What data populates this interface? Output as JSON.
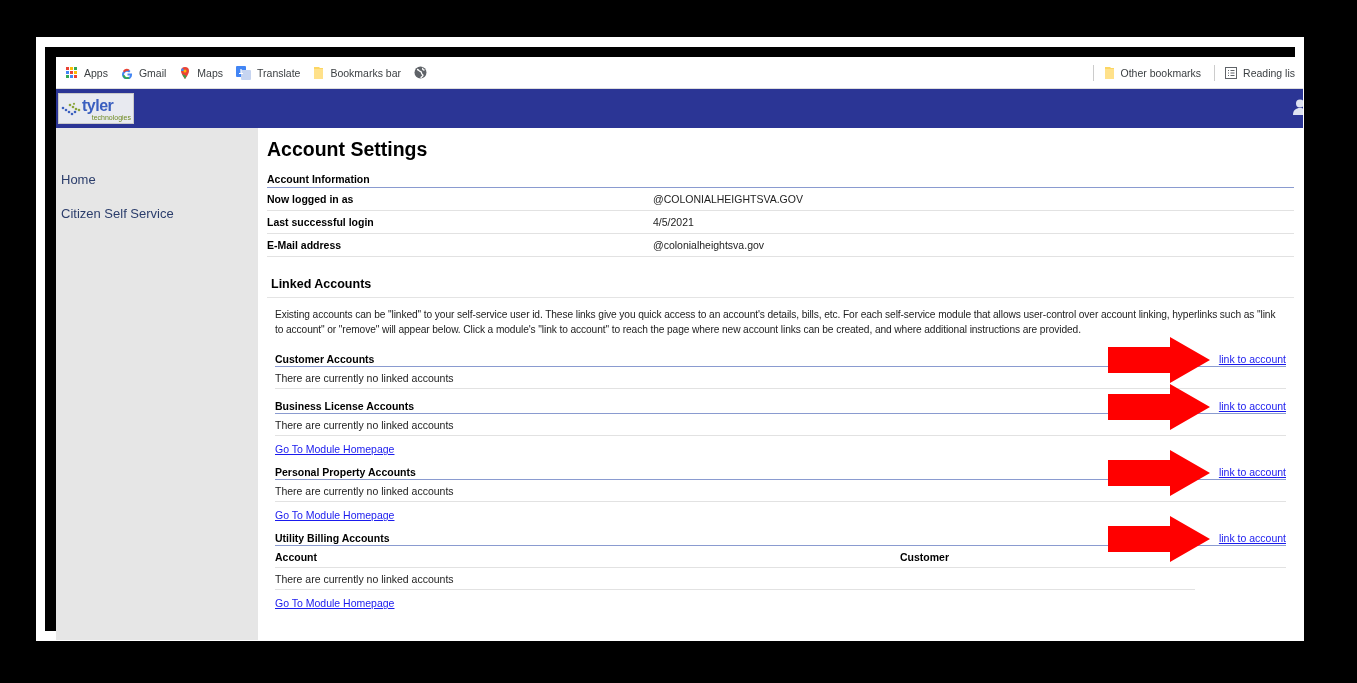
{
  "bookmarks_bar": {
    "items": [
      {
        "kind": "apps",
        "label": "Apps"
      },
      {
        "kind": "gmail",
        "label": "Gmail"
      },
      {
        "kind": "maps",
        "label": "Maps"
      },
      {
        "kind": "translate",
        "label": "Translate"
      },
      {
        "kind": "folder",
        "label": "Bookmarks bar"
      },
      {
        "kind": "globe"
      }
    ],
    "right_items": [
      {
        "kind": "folder",
        "label": "Other bookmarks"
      },
      {
        "kind": "reading",
        "label": "Reading lis"
      }
    ]
  },
  "header": {
    "logo": {
      "name": "tyler",
      "subtitle": "technologies"
    }
  },
  "sidebar": {
    "items": [
      "Home",
      "Citizen Self Service"
    ]
  },
  "page": {
    "title": "Account Settings",
    "account_information": {
      "heading": "Account Information",
      "rows": [
        {
          "label": "Now logged in as",
          "value": "@COLONIALHEIGHTSVA.GOV"
        },
        {
          "label": "Last successful login",
          "value": "4/5/2021"
        },
        {
          "label": "E-Mail address",
          "value": "@colonialheightsva.gov"
        }
      ]
    },
    "linked_accounts": {
      "heading": "Linked Accounts",
      "intro": "Existing accounts can be \"linked\" to your self-service user id. These links give you quick access to an account's details, bills, etc. For each self-service module that allows user-control over account linking, hyperlinks such as \"link to account\" or \"remove\" will appear below. Click a module's \"link to account\" to reach the page where new account links can be created, and where additional instructions are provided.",
      "sections": [
        {
          "title": "Customer Accounts",
          "link": "link to account",
          "highlighted": true,
          "message": "There are currently no linked accounts"
        },
        {
          "title": "Business License Accounts",
          "link": "link to account",
          "highlighted": true,
          "message": "There are currently no linked accounts",
          "homepage_link": "Go To Module Homepage"
        },
        {
          "title": "Personal Property Accounts",
          "link": "link to account",
          "highlighted": true,
          "message": "There are currently no linked accounts",
          "homepage_link": "Go To Module Homepage"
        },
        {
          "title": "Utility Billing Accounts",
          "link": "link to account",
          "highlighted": true,
          "columns": [
            "Account",
            "Customer"
          ],
          "message": "There are currently no linked accounts",
          "homepage_link": "Go To Module Homepage"
        }
      ]
    }
  }
}
